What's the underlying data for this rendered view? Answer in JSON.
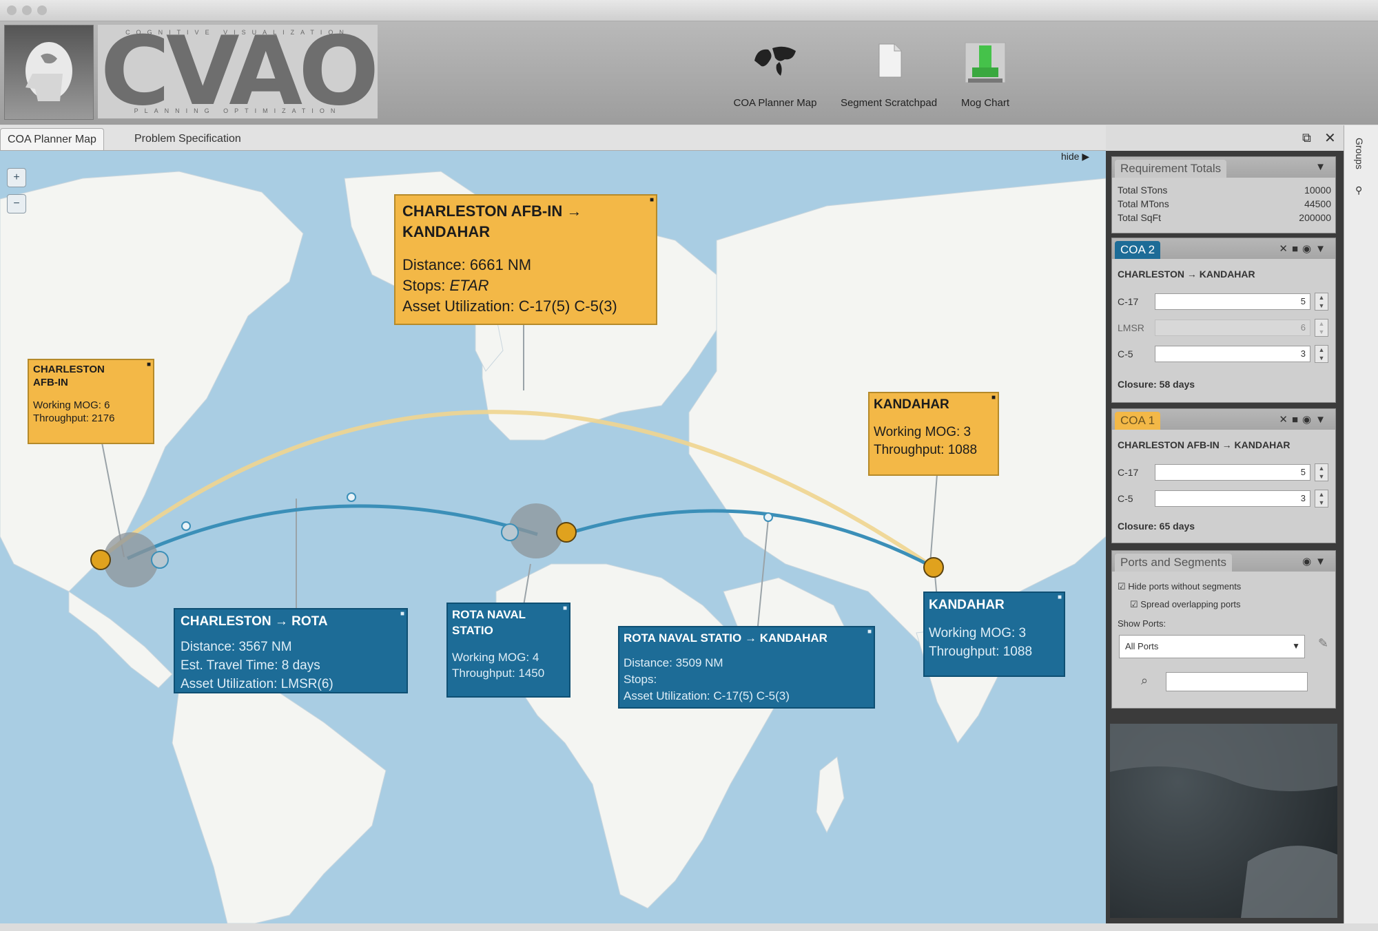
{
  "app": {
    "logo_text": "CVAO",
    "logo_top": "COGNITIVE VISUALIZATION",
    "logo_bottom": "PLANNING OPTIMIZATION"
  },
  "toolbar": [
    {
      "label": "COA Planner Map",
      "icon": "world-map-icon"
    },
    {
      "label": "Segment Scratchpad",
      "icon": "document-icon"
    },
    {
      "label": "Mog Chart",
      "icon": "bar-chart-icon"
    }
  ],
  "tabs": [
    "COA Planner Map",
    "Problem Specification"
  ],
  "map": {
    "hide_label": "hide ▶",
    "zoom_in": "+",
    "zoom_out": "−"
  },
  "callouts": {
    "route_gold": {
      "title_line1": "CHARLESTON AFB-IN →",
      "title_line2": "KANDAHAR",
      "distance": "Distance: 6661 NM",
      "stops_label": "Stops: ",
      "stops_value": "ETAR",
      "asset": "Asset Utilization: C-17(5) C-5(3)"
    },
    "charleston_gold": {
      "title_line1": "CHARLESTON",
      "title_line2": "AFB-IN",
      "mog": "Working MOG: 6",
      "throughput": "Throughput: 2176"
    },
    "kandahar_gold": {
      "title": "KANDAHAR",
      "mog": "Working MOG: 3",
      "throughput": "Throughput: 1088"
    },
    "charleston_rota": {
      "title": "CHARLESTON → ROTA",
      "distance": "Distance: 3567 NM",
      "travel": "Est. Travel Time: 8 days",
      "asset": "Asset Utilization: LMSR(6)"
    },
    "rota": {
      "title_line1": "ROTA NAVAL",
      "title_line2": "STATIO",
      "mog": "Working MOG: 4",
      "throughput": "Throughput: 1450"
    },
    "rota_kandahar": {
      "title": "ROTA NAVAL STATIO → KANDAHAR",
      "distance": "Distance: 3509 NM",
      "stops": "Stops:",
      "asset": "Asset Utilization: C-17(5) C-5(3)"
    },
    "kandahar_blue": {
      "title": "KANDAHAR",
      "mog": "Working MOG: 3",
      "throughput": "Throughput: 1088"
    }
  },
  "panel": {
    "requirement_totals": {
      "title": "Requirement Totals",
      "rows": [
        {
          "label": "Total STons",
          "value": "10000"
        },
        {
          "label": "Total MTons",
          "value": "44500"
        },
        {
          "label": "Total SqFt",
          "value": "200000"
        }
      ]
    },
    "coa2": {
      "tab": "COA 2",
      "route": "CHARLESTON → KANDAHAR",
      "assets": [
        {
          "label": "C-17",
          "value": "5"
        },
        {
          "label": "LMSR",
          "value": "6"
        },
        {
          "label": "C-5",
          "value": "3"
        }
      ],
      "closure": "Closure: 58 days"
    },
    "coa1": {
      "tab": "COA 1",
      "route": "CHARLESTON AFB-IN → KANDAHAR",
      "assets": [
        {
          "label": "C-17",
          "value": "5"
        },
        {
          "label": "C-5",
          "value": "3"
        }
      ],
      "closure": "Closure: 65 days"
    },
    "ports": {
      "title": "Ports and Segments",
      "opt1": "Hide ports without segments",
      "opt2": "Spread overlapping ports",
      "show_ports_label": "Show Ports:",
      "show_ports_value": "All Ports",
      "search_placeholder": ""
    }
  },
  "rail": {
    "groups_label": "Groups"
  },
  "colors": {
    "gold": "#f3b847",
    "blue": "#1d6c97",
    "ocean": "#a9cde3",
    "land": "#f4f5f2"
  }
}
